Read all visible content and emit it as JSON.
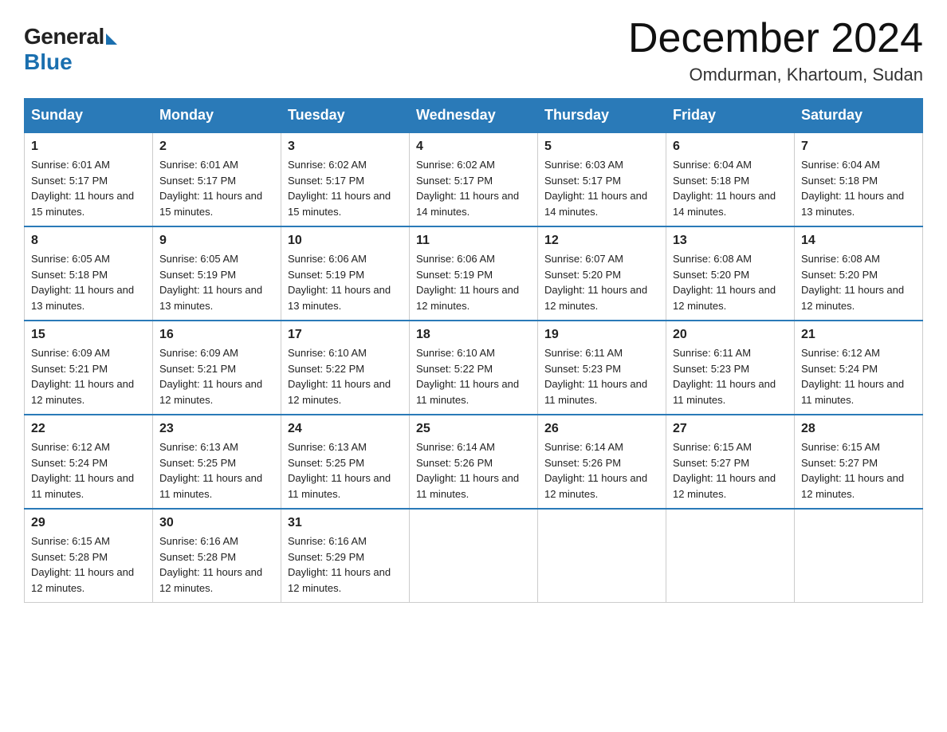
{
  "header": {
    "logo_general": "General",
    "logo_blue": "Blue",
    "month_year": "December 2024",
    "location": "Omdurman, Khartoum, Sudan"
  },
  "days_of_week": [
    "Sunday",
    "Monday",
    "Tuesday",
    "Wednesday",
    "Thursday",
    "Friday",
    "Saturday"
  ],
  "weeks": [
    [
      {
        "day": "1",
        "sunrise": "6:01 AM",
        "sunset": "5:17 PM",
        "daylight": "11 hours and 15 minutes."
      },
      {
        "day": "2",
        "sunrise": "6:01 AM",
        "sunset": "5:17 PM",
        "daylight": "11 hours and 15 minutes."
      },
      {
        "day": "3",
        "sunrise": "6:02 AM",
        "sunset": "5:17 PM",
        "daylight": "11 hours and 15 minutes."
      },
      {
        "day": "4",
        "sunrise": "6:02 AM",
        "sunset": "5:17 PM",
        "daylight": "11 hours and 14 minutes."
      },
      {
        "day": "5",
        "sunrise": "6:03 AM",
        "sunset": "5:17 PM",
        "daylight": "11 hours and 14 minutes."
      },
      {
        "day": "6",
        "sunrise": "6:04 AM",
        "sunset": "5:18 PM",
        "daylight": "11 hours and 14 minutes."
      },
      {
        "day": "7",
        "sunrise": "6:04 AM",
        "sunset": "5:18 PM",
        "daylight": "11 hours and 13 minutes."
      }
    ],
    [
      {
        "day": "8",
        "sunrise": "6:05 AM",
        "sunset": "5:18 PM",
        "daylight": "11 hours and 13 minutes."
      },
      {
        "day": "9",
        "sunrise": "6:05 AM",
        "sunset": "5:19 PM",
        "daylight": "11 hours and 13 minutes."
      },
      {
        "day": "10",
        "sunrise": "6:06 AM",
        "sunset": "5:19 PM",
        "daylight": "11 hours and 13 minutes."
      },
      {
        "day": "11",
        "sunrise": "6:06 AM",
        "sunset": "5:19 PM",
        "daylight": "11 hours and 12 minutes."
      },
      {
        "day": "12",
        "sunrise": "6:07 AM",
        "sunset": "5:20 PM",
        "daylight": "11 hours and 12 minutes."
      },
      {
        "day": "13",
        "sunrise": "6:08 AM",
        "sunset": "5:20 PM",
        "daylight": "11 hours and 12 minutes."
      },
      {
        "day": "14",
        "sunrise": "6:08 AM",
        "sunset": "5:20 PM",
        "daylight": "11 hours and 12 minutes."
      }
    ],
    [
      {
        "day": "15",
        "sunrise": "6:09 AM",
        "sunset": "5:21 PM",
        "daylight": "11 hours and 12 minutes."
      },
      {
        "day": "16",
        "sunrise": "6:09 AM",
        "sunset": "5:21 PM",
        "daylight": "11 hours and 12 minutes."
      },
      {
        "day": "17",
        "sunrise": "6:10 AM",
        "sunset": "5:22 PM",
        "daylight": "11 hours and 12 minutes."
      },
      {
        "day": "18",
        "sunrise": "6:10 AM",
        "sunset": "5:22 PM",
        "daylight": "11 hours and 11 minutes."
      },
      {
        "day": "19",
        "sunrise": "6:11 AM",
        "sunset": "5:23 PM",
        "daylight": "11 hours and 11 minutes."
      },
      {
        "day": "20",
        "sunrise": "6:11 AM",
        "sunset": "5:23 PM",
        "daylight": "11 hours and 11 minutes."
      },
      {
        "day": "21",
        "sunrise": "6:12 AM",
        "sunset": "5:24 PM",
        "daylight": "11 hours and 11 minutes."
      }
    ],
    [
      {
        "day": "22",
        "sunrise": "6:12 AM",
        "sunset": "5:24 PM",
        "daylight": "11 hours and 11 minutes."
      },
      {
        "day": "23",
        "sunrise": "6:13 AM",
        "sunset": "5:25 PM",
        "daylight": "11 hours and 11 minutes."
      },
      {
        "day": "24",
        "sunrise": "6:13 AM",
        "sunset": "5:25 PM",
        "daylight": "11 hours and 11 minutes."
      },
      {
        "day": "25",
        "sunrise": "6:14 AM",
        "sunset": "5:26 PM",
        "daylight": "11 hours and 11 minutes."
      },
      {
        "day": "26",
        "sunrise": "6:14 AM",
        "sunset": "5:26 PM",
        "daylight": "11 hours and 12 minutes."
      },
      {
        "day": "27",
        "sunrise": "6:15 AM",
        "sunset": "5:27 PM",
        "daylight": "11 hours and 12 minutes."
      },
      {
        "day": "28",
        "sunrise": "6:15 AM",
        "sunset": "5:27 PM",
        "daylight": "11 hours and 12 minutes."
      }
    ],
    [
      {
        "day": "29",
        "sunrise": "6:15 AM",
        "sunset": "5:28 PM",
        "daylight": "11 hours and 12 minutes."
      },
      {
        "day": "30",
        "sunrise": "6:16 AM",
        "sunset": "5:28 PM",
        "daylight": "11 hours and 12 minutes."
      },
      {
        "day": "31",
        "sunrise": "6:16 AM",
        "sunset": "5:29 PM",
        "daylight": "11 hours and 12 minutes."
      },
      null,
      null,
      null,
      null
    ]
  ]
}
